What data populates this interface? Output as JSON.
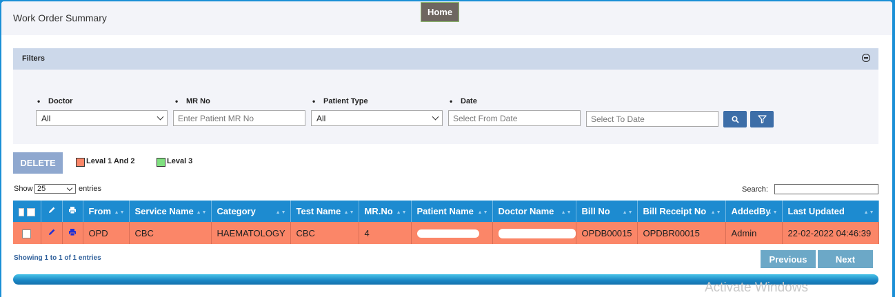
{
  "header": {
    "title": "Work Order Summary",
    "home_label": "Home"
  },
  "filters": {
    "title": "Filters",
    "doctor_label": "Doctor",
    "doctor_value": "All",
    "mr_label": "MR No",
    "mr_placeholder": "Enter Patient MR No",
    "patient_type_label": "Patient Type",
    "patient_type_value": "All",
    "date_label": "Date",
    "from_placeholder": "Select From Date",
    "to_placeholder": "Select To Date"
  },
  "toolbar": {
    "delete_label": "DELETE",
    "legend": [
      {
        "label": "Leval 1 And 2",
        "color": "#fb8668"
      },
      {
        "label": "Leval 3",
        "color": "#7fe07f"
      }
    ]
  },
  "listing": {
    "show_label": "Show",
    "entries_value": "25",
    "entries_label": "entries",
    "search_label": "Search:",
    "showing_text": "Showing 1 to 1 of 1 entries"
  },
  "table": {
    "columns": [
      "From",
      "Service Name",
      "Category",
      "Test Name",
      "MR.No",
      "Patient Name",
      "Doctor Name",
      "Bill No",
      "Bill Receipt No",
      "AddedBy",
      "Last Updated"
    ],
    "rows": [
      {
        "from": "OPD",
        "service_name": "CBC",
        "category": "HAEMATOLOGY",
        "test_name": "CBC",
        "mr_no": "4",
        "bill_no": "OPDB00015",
        "bill_receipt_no": "OPDBR00015",
        "added_by": "Admin",
        "last_updated": "22-02-2022 04:46:39"
      }
    ]
  },
  "pager": {
    "previous_label": "Previous",
    "next_label": "Next"
  },
  "watermark": "Activate Windows",
  "colors": {
    "header_blue": "#1d8bd0",
    "row_level_1_2": "#fb8668",
    "home_button": "#6e6660",
    "icon_button": "#3d6ea8"
  }
}
